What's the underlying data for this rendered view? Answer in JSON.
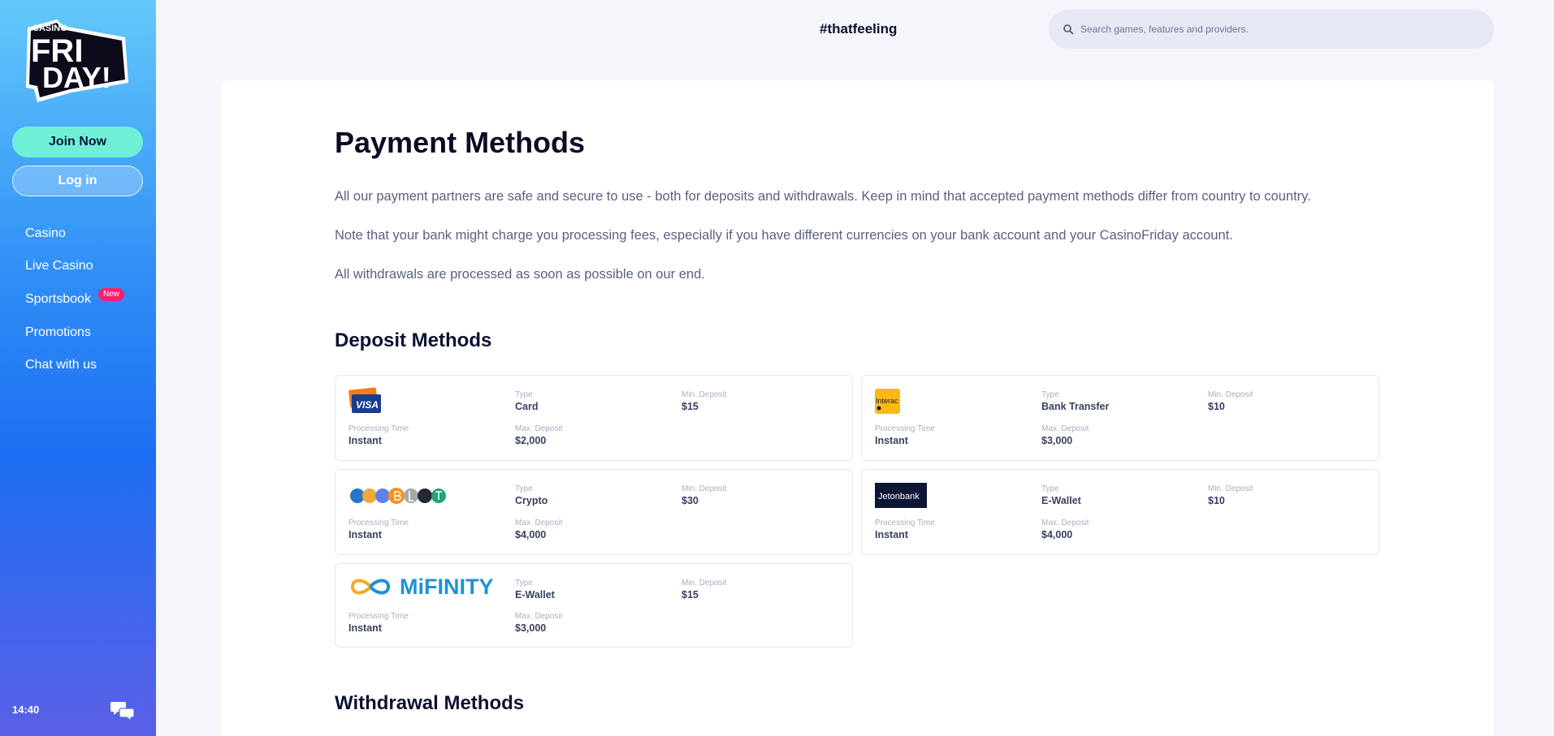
{
  "brand": {
    "logo_text_top": "CASINO",
    "logo_text_line1": "FRI",
    "logo_text_line2": "DAY!"
  },
  "sidebar": {
    "join_label": "Join Now",
    "login_label": "Log in",
    "items": [
      {
        "label": "Casino"
      },
      {
        "label": "Live Casino"
      },
      {
        "label": "Sportsbook",
        "badge": "New"
      },
      {
        "label": "Promotions"
      },
      {
        "label": "Chat with us"
      }
    ],
    "time": "14:40"
  },
  "header": {
    "tagline": "#thatfeeling",
    "search_placeholder": "Search games, features and providers."
  },
  "page": {
    "title": "Payment Methods",
    "paragraphs": [
      "All our payment partners are safe and secure to use - both for deposits and withdrawals. Keep in mind that accepted payment methods differ from country to country.",
      "Note that your bank might charge you processing fees, especially if you have different currencies on your bank account and your CasinoFriday account.",
      "All withdrawals are processed as soon as possible on our end."
    ],
    "deposit_heading": "Deposit Methods",
    "withdrawal_heading": "Withdrawal Methods",
    "labels": {
      "type": "Type",
      "min_deposit": "Min. Deposit",
      "processing_time": "Processing Time",
      "max_deposit": "Max. Deposit"
    },
    "deposit_methods": [
      {
        "logo": "visa-card-icon",
        "logo_text": "VISA",
        "type": "Card",
        "min": "$15",
        "processing": "Instant",
        "max": "$2,000"
      },
      {
        "logo": "interac-icon",
        "logo_text": "Interac",
        "type": "Bank Transfer",
        "min": "$10",
        "processing": "Instant",
        "max": "$3,000"
      },
      {
        "logo": "crypto-coins-icon",
        "logo_text": "",
        "type": "Crypto",
        "min": "$30",
        "processing": "Instant",
        "max": "$4,000"
      },
      {
        "logo": "jetonbank-icon",
        "logo_text": "Jetonbank",
        "type": "E-Wallet",
        "min": "$10",
        "processing": "Instant",
        "max": "$4,000"
      },
      {
        "logo": "mifinity-icon",
        "logo_text": "MiFINITY",
        "type": "E-Wallet",
        "min": "$15",
        "processing": "Instant",
        "max": "$3,000"
      }
    ]
  },
  "colors": {
    "join_button": "#6ff0d6",
    "badge_new": "#ff1e6d",
    "sidebar_top": "#63c9fb",
    "sidebar_bottom": "#5b5fe6"
  }
}
